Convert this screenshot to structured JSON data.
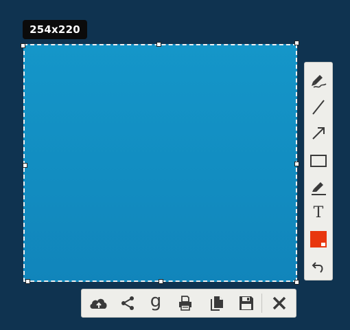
{
  "selection": {
    "size_label": "254x220"
  },
  "side_toolbar": {
    "tools": [
      {
        "name": "freehand",
        "icon": "pencil-squiggle-icon"
      },
      {
        "name": "line",
        "icon": "line-icon"
      },
      {
        "name": "arrow",
        "icon": "arrow-icon"
      },
      {
        "name": "rectangle",
        "icon": "rectangle-icon"
      },
      {
        "name": "marker",
        "icon": "marker-icon"
      },
      {
        "name": "text",
        "icon": "text-icon",
        "glyph": "T"
      },
      {
        "name": "color",
        "icon": "color-swatch-icon"
      },
      {
        "name": "undo",
        "icon": "undo-icon"
      }
    ],
    "current_color": "#e8360e"
  },
  "bottom_toolbar": {
    "actions": [
      {
        "name": "upload",
        "icon": "cloud-upload-icon"
      },
      {
        "name": "share",
        "icon": "share-icon"
      },
      {
        "name": "google-search",
        "icon": "google-icon",
        "glyph": "g"
      },
      {
        "name": "print",
        "icon": "print-icon"
      },
      {
        "name": "copy",
        "icon": "copy-icon"
      },
      {
        "name": "save",
        "icon": "save-icon"
      },
      {
        "name": "close",
        "icon": "close-icon"
      }
    ]
  },
  "colors": {
    "background": "#0f3350",
    "selection_fill": "#1390c5",
    "toolbar_bg": "#eeeeea",
    "icon": "#3a3a3a"
  }
}
